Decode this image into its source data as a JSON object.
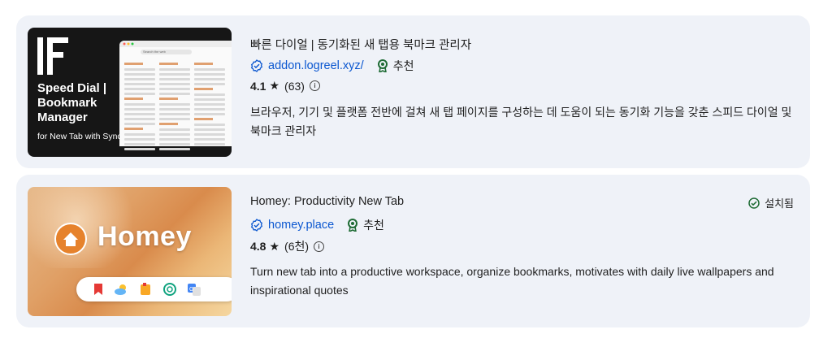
{
  "results": [
    {
      "title": "빠른 다이얼 | 동기화된 새 탭용 북마크 관리자",
      "publisher": "addon.logreel.xyz/",
      "recommended_label": "추천",
      "rating": "4.1",
      "rating_count": "(63)",
      "description": "브라우저, 기기 및 플랫폼 전반에 걸쳐 새 탭 페이지를 구성하는 데 도움이 되는 동기화 기능을 갖춘 스피드 다이얼 및 북마크 관리자",
      "thumbnail": {
        "title_lines": [
          "Speed Dial |",
          "Bookmark",
          "Manager"
        ],
        "subtitle": "for New Tab with Sync",
        "search_text": "Search the web",
        "accent": "#161616"
      }
    },
    {
      "title": "Homey: Productivity New Tab",
      "publisher": "homey.place",
      "recommended_label": "추천",
      "rating": "4.8",
      "rating_count": "(6천)",
      "installed_label": "설치됨",
      "description": "Turn new tab into a productive workspace, organize bookmarks, motivates with daily live wallpapers and inspirational quotes",
      "thumbnail": {
        "brand": "Homey",
        "accent": "#e6822c"
      }
    }
  ],
  "colors": {
    "card_bg": "#eff2f8",
    "link": "#0b57d0",
    "badge_green": "#1e6b34"
  },
  "icons": [
    "verified-check-icon",
    "recommended-ribbon-icon",
    "star-icon",
    "info-icon",
    "installed-check-icon",
    "home-icon"
  ]
}
